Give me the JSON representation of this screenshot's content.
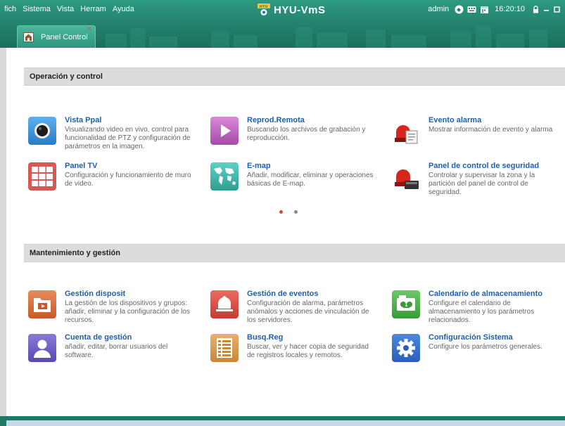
{
  "menu": [
    "fich",
    "Sistema",
    "Vista",
    "Herram",
    "Ayuda"
  ],
  "brand": {
    "name": "HYU-VmS",
    "logo_text": "HYU"
  },
  "status": {
    "user": "admin",
    "time": "16:20:10"
  },
  "tab": {
    "label": "Panel Control"
  },
  "sections": {
    "operation": {
      "title": "Operación y control",
      "items": [
        {
          "title": "Vista Ppal",
          "desc": "Visualizando video en vivo, control para funcionalidad de PTZ y configuración de parámetros en la imagen.",
          "icon": "camera-icon"
        },
        {
          "title": "Reprod.Remota",
          "desc": "Buscando los archivos de grabación y reproducción.",
          "icon": "play-icon"
        },
        {
          "title": "Evento alarma",
          "desc": "Mostrar información de evento y alarma",
          "icon": "alarm-event-icon"
        },
        {
          "title": "Panel TV",
          "desc": "Configuración y funcionamiento de muro de video.",
          "icon": "video-wall-icon"
        },
        {
          "title": "E-map",
          "desc": "Añadir, modificar, eliminar y operaciones básicas de E-map.",
          "icon": "world-map-icon"
        },
        {
          "title": "Panel de control de seguridad",
          "desc": "Controlar y supervisar la zona y la partición del panel de control de seguridad.",
          "icon": "security-panel-icon"
        }
      ]
    },
    "maintenance": {
      "title": "Mantenimiento y gestión",
      "items": [
        {
          "title": "Gestión disposit",
          "desc": "La gestión de los dispositivos y grupos: añadir, eliminar y la configuración de los recursos.",
          "icon": "device-folder-icon"
        },
        {
          "title": "Gestión de eventos",
          "desc": "Configuración de alarma, parámetros anómalos y acciones de vinculación de los servidores.",
          "icon": "bell-icon"
        },
        {
          "title": "Calendario de almacenamiento",
          "desc": "Configure el calendario de almacenamiento y los parámetros relacionados.",
          "icon": "tape-recorder-icon"
        },
        {
          "title": "Cuenta de gestión",
          "desc": "añadir, editar, borrar usuarios del software.",
          "icon": "user-icon"
        },
        {
          "title": "Busq.Reg",
          "desc": "Buscar, ver y hacer copia de seguridad de registros locales y remotos.",
          "icon": "log-list-icon"
        },
        {
          "title": "Configuración Sistema",
          "desc": "Configure los parámetros generales.",
          "icon": "gear-icon"
        }
      ]
    }
  },
  "pager": {
    "pages": 2,
    "active": 1
  },
  "colors": {
    "accent": "#1f5fae",
    "titlebar": "#23806b",
    "dot_active": "#d9472b",
    "dot_inactive": "#888888"
  }
}
